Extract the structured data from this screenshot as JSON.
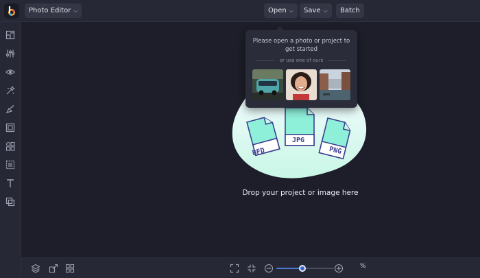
{
  "topbar": {
    "app_menu_label": "Photo Editor",
    "open_label": "Open",
    "save_label": "Save",
    "batch_label": "Batch"
  },
  "popup": {
    "title": "Please open a photo or project to get started",
    "or_text": "or use one of ours",
    "samples": [
      "van-sample-photo",
      "woman-sample-photo",
      "canal-sample-photo"
    ]
  },
  "dropzone": {
    "file_types": [
      "BFD",
      "JPG",
      "PNG"
    ],
    "message": "Drop your project or image here"
  },
  "sidebar": {
    "icons": [
      "image-icon",
      "adjustments-icon",
      "eye-icon",
      "effects-icon",
      "paint-icon",
      "frame-icon",
      "graphics-icon",
      "texture-icon",
      "text-icon",
      "overlay-icon"
    ]
  },
  "bottombar": {
    "zoom_percent_label": "%",
    "zoom_level": 0.45
  },
  "colors": {
    "background": "#1d1e29",
    "panel": "#262835",
    "blob_light": "#dffcf1",
    "file_fill": "#8ff0da",
    "file_stroke": "#3b3f8f",
    "accent": "#3b64c8"
  }
}
